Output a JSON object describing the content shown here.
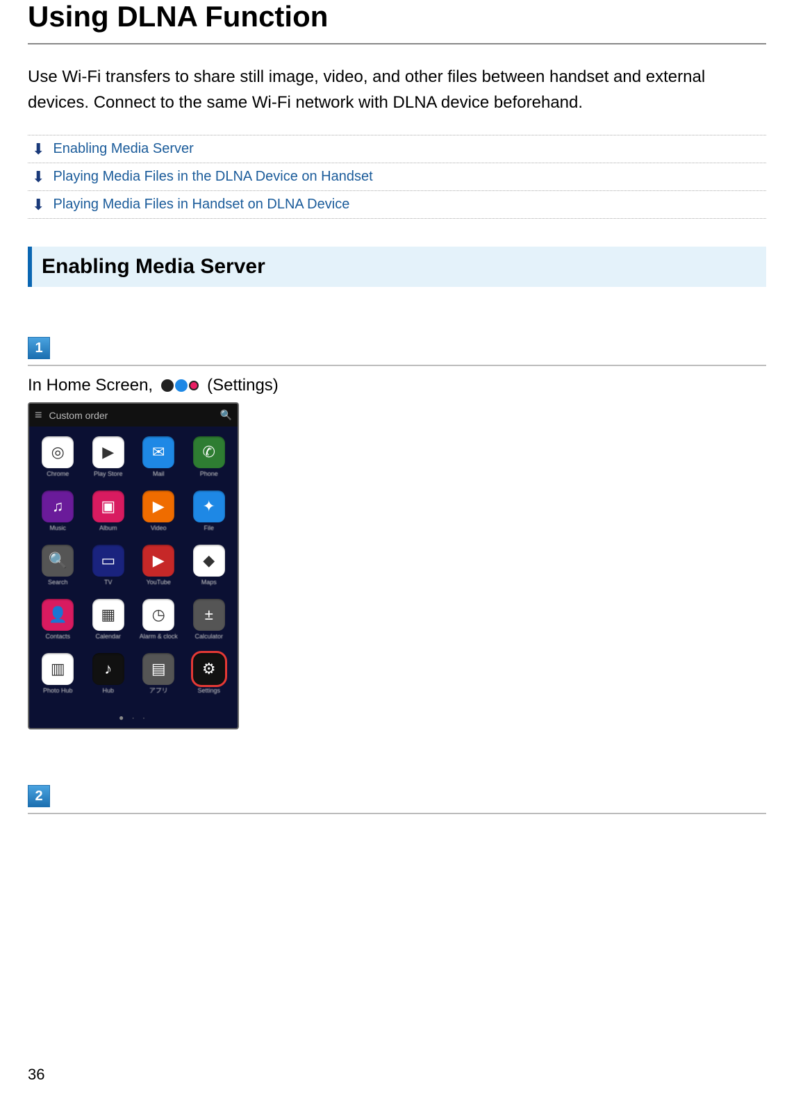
{
  "page": {
    "title": "Using DLNA Function",
    "intro": "Use Wi-Fi transfers to share still image, video, and other files between handset and external devices. Connect to the same Wi-Fi network with DLNA device beforehand.",
    "page_number": "36"
  },
  "toc": {
    "items": [
      {
        "label": "Enabling Media Server"
      },
      {
        "label": "Playing Media Files in the DLNA Device on Handset"
      },
      {
        "label": "Playing Media Files in Handset on DLNA Device"
      }
    ]
  },
  "section": {
    "heading": "Enabling Media Server"
  },
  "steps": [
    {
      "number": "1",
      "line_prefix": "In Home Screen,",
      "line_suffix": "(Settings)"
    },
    {
      "number": "2"
    }
  ],
  "phone": {
    "topbar_label": "Custom order",
    "dots": "●  ·  ·",
    "apps": [
      {
        "label": "Chrome",
        "bg": "bg-white",
        "glyph": "◎"
      },
      {
        "label": "Play Store",
        "bg": "bg-white",
        "glyph": "▶"
      },
      {
        "label": "Mail",
        "bg": "bg-lblue",
        "glyph": "✉"
      },
      {
        "label": "Phone",
        "bg": "bg-green",
        "glyph": "✆"
      },
      {
        "label": "Music",
        "bg": "bg-purple",
        "glyph": "♫"
      },
      {
        "label": "Album",
        "bg": "bg-pink",
        "glyph": "▣"
      },
      {
        "label": "Video",
        "bg": "bg-orange",
        "glyph": "▶"
      },
      {
        "label": "File",
        "bg": "bg-lblue",
        "glyph": "✦"
      },
      {
        "label": "Search",
        "bg": "bg-grey",
        "glyph": "🔍"
      },
      {
        "label": "TV",
        "bg": "bg-navy",
        "glyph": "▭"
      },
      {
        "label": "YouTube",
        "bg": "bg-red",
        "glyph": "▶"
      },
      {
        "label": "Maps",
        "bg": "bg-white",
        "glyph": "◆"
      },
      {
        "label": "Contacts",
        "bg": "bg-pink",
        "glyph": "👤"
      },
      {
        "label": "Calendar",
        "bg": "bg-white",
        "glyph": "▦"
      },
      {
        "label": "Alarm & clock",
        "bg": "bg-white",
        "glyph": "◷"
      },
      {
        "label": "Calculator",
        "bg": "bg-grey",
        "glyph": "±"
      },
      {
        "label": "Photo Hub",
        "bg": "bg-white",
        "glyph": "▥"
      },
      {
        "label": "Hub",
        "bg": "bg-dark",
        "glyph": "♪"
      },
      {
        "label": "アプリ",
        "bg": "bg-grey",
        "glyph": "▤"
      },
      {
        "label": "Settings",
        "bg": "bg-dark",
        "glyph": "⚙",
        "highlight": true
      }
    ]
  }
}
